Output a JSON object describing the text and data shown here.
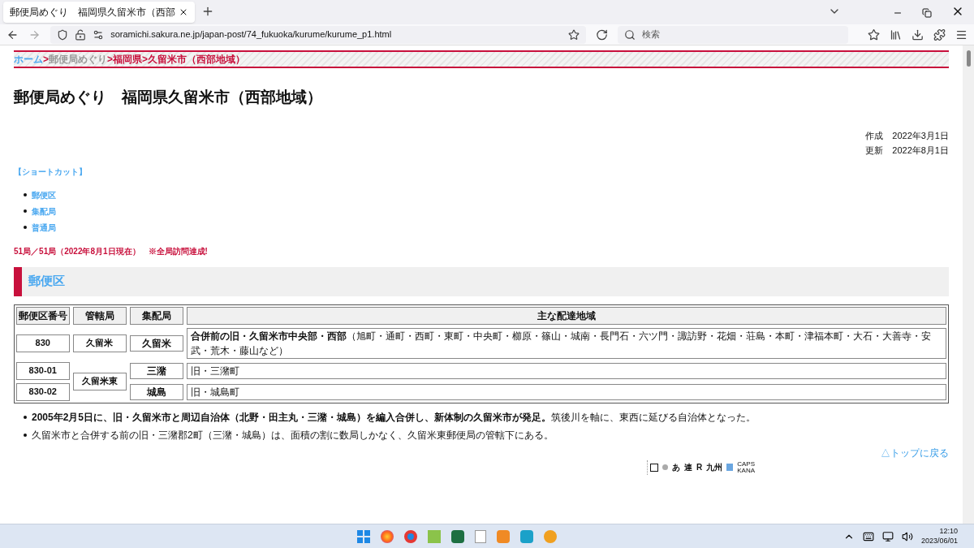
{
  "browser": {
    "tab_title": "郵便局めぐり　福岡県久留米市（西部",
    "url": "soramichi.sakura.ne.jp/japan-post/74_fukuoka/kurume/kurume_p1.html",
    "search_placeholder": "検索"
  },
  "breadcrumb": [
    {
      "kind": "link",
      "text": "ホーム"
    },
    {
      "kind": "separator",
      "text": ">"
    },
    {
      "kind": "visited",
      "text": "郵便局めぐり"
    },
    {
      "kind": "separator",
      "text": ">"
    },
    {
      "kind": "current",
      "text": "福岡県"
    },
    {
      "kind": "separator",
      "text": ">"
    },
    {
      "kind": "current",
      "text": "久留米市（西部地域）"
    }
  ],
  "title": "郵便局めぐり　福岡県久留米市（西部地域）",
  "dates": [
    {
      "label": "作成",
      "value": "2022年3月1日"
    },
    {
      "label": "更新",
      "value": "2022年8月1日"
    }
  ],
  "shortcut_label": "【ショートカット】",
  "shortcuts": [
    "郵便区",
    "集配局",
    "普通局"
  ],
  "progress": "51局／51局（2022年8月1日現在）　※全局訪問達成!",
  "section_title": "郵便区",
  "table": {
    "columns": [
      "郵便区番号",
      "管轄局",
      "集配局",
      "主な配達地域"
    ],
    "rows": [
      {
        "code": "830",
        "office": "久留米",
        "delivery": "久留米",
        "area": "**合併前の旧・久留米市中央部・西部**（旭町・通町・西町・東町・中央町・櫛原・篠山・城南・長門石・六ツ門・諏訪野・花畑・荘島・本町・津福本町・大石・大善寺・安武・荒木・藤山など）"
      },
      {
        "code": "830-01",
        "office": "久留米東",
        "delivery": "三潴",
        "area": "旧・三潴町"
      },
      {
        "code": "830-02",
        "delivery": "城島",
        "area": "旧・城島町"
      }
    ]
  },
  "notes": [
    "**2005年2月5日に、旧・久留米市と周辺自治体（北野・田主丸・三潴・城島）を編入合併し、新体制の久留米市が発足。**筑後川を軸に、東西に延びる自治体となった。",
    "久留米市と合併する前の旧・三潴郡2町（三潴・城島）は、面積の割に数局しかなく、久留米東郵便局の管轄下にある。"
  ],
  "back_to_top": "△トップに戻る",
  "ime_toolbar": [
    "あ",
    "連",
    "R",
    "九州"
  ],
  "ime_status": [
    "CAPS",
    "KANA"
  ],
  "taskbar": {
    "time": "12:10",
    "date": "2023/06/01"
  }
}
